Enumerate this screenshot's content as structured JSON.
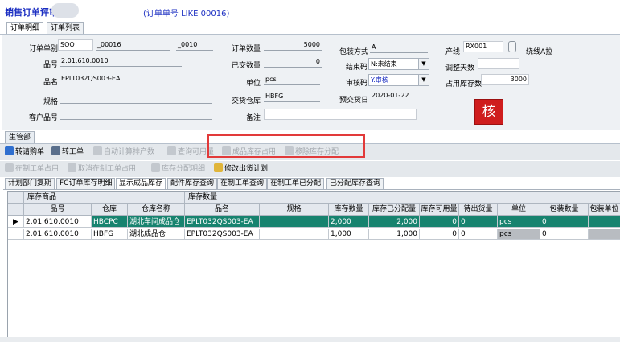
{
  "window": {
    "title": "销售订单评审",
    "subtitle": "(订单单号 LIKE 00016)"
  },
  "tabs": [
    "订单明细",
    "订单列表"
  ],
  "form": {
    "order_no_label": "订单单别",
    "order_type": "SOO",
    "order_no": "_00016",
    "order_seq": "_0010",
    "part_no_label": "品号",
    "part_no": "2.01.610.0010",
    "part_name_label": "品名",
    "part_name": "EPLT032QS003-EA",
    "spec_label": "规格",
    "spec": "",
    "customer_part_label": "客户品号",
    "customer_part": "",
    "order_qty_label": "订单数量",
    "order_qty": "5000",
    "delivered_qty_label": "已交数量",
    "delivered_qty": "0",
    "unit_label": "单位",
    "unit": "pcs",
    "warehouse_label": "交货仓库",
    "warehouse": "HBFG",
    "remark_label": "备注",
    "remark": "",
    "pack_label": "包装方式",
    "pack": "A",
    "close_code_label": "结束码",
    "close_code": "N:未结束",
    "audit_code_label": "审核码",
    "audit_code": "Y.审核",
    "expected_date_label": "预交货日",
    "expected_date": "2020-01-22",
    "line_label": "产线",
    "line": "RX001",
    "line_status": "绕线A拉",
    "adjust_days_label": "调整天数",
    "adjust_days": "",
    "stock_used_label": "占用库存数",
    "stock_used": "3000",
    "approve_button": "核"
  },
  "group_tab": "生管部",
  "toolbar1": [
    {
      "label": "转请购单",
      "enabled": true,
      "icon": "request-icon"
    },
    {
      "label": "转工单",
      "enabled": true,
      "icon": "workorder-icon"
    },
    {
      "label": "自动计算排产数",
      "enabled": false,
      "icon": "calc-icon"
    },
    {
      "label": "查询可用量",
      "enabled": false,
      "icon": "query-icon"
    },
    {
      "label": "成品库存占用",
      "enabled": false,
      "icon": "stock-icon"
    },
    {
      "label": "移除库存分配",
      "enabled": false,
      "icon": "remove-icon"
    }
  ],
  "toolbar2": [
    {
      "label": "在制工单占用",
      "enabled": false,
      "icon": "wip-icon"
    },
    {
      "label": "取消在制工单占用",
      "enabled": false,
      "icon": "cancel-icon"
    },
    {
      "label": "库存分配明细",
      "enabled": false,
      "icon": "detail-icon"
    },
    {
      "label": "修改出货计划",
      "enabled": true,
      "icon": "edit-icon"
    }
  ],
  "subtabs": [
    "计划部门复期",
    "FC订单库存明细",
    "显示成品库存",
    "配件库存查询",
    "在制工单查询",
    "在制工单已分配",
    "已分配库存查询"
  ],
  "grid": {
    "group_headers": [
      "库存商品",
      "库存数量"
    ],
    "columns": [
      "品号",
      "仓库",
      "仓库名称",
      "品名",
      "规格",
      "库存数量",
      "库存已分配量",
      "库存可用量",
      "待出货量",
      "单位",
      "包装数量",
      "包装单位"
    ],
    "rows": [
      [
        "2.01.610.0010",
        "HBCPC",
        "湖北车间成品仓",
        "EPLT032QS003-EA",
        "",
        "2,000",
        "2,000",
        "0",
        "0",
        "pcs",
        "0",
        ""
      ],
      [
        "2.01.610.0010",
        "HBFG",
        "湖北成品仓",
        "EPLT032QS003-EA",
        "",
        "1,000",
        "1,000",
        "0",
        "0",
        "pcs",
        "0",
        ""
      ]
    ]
  }
}
